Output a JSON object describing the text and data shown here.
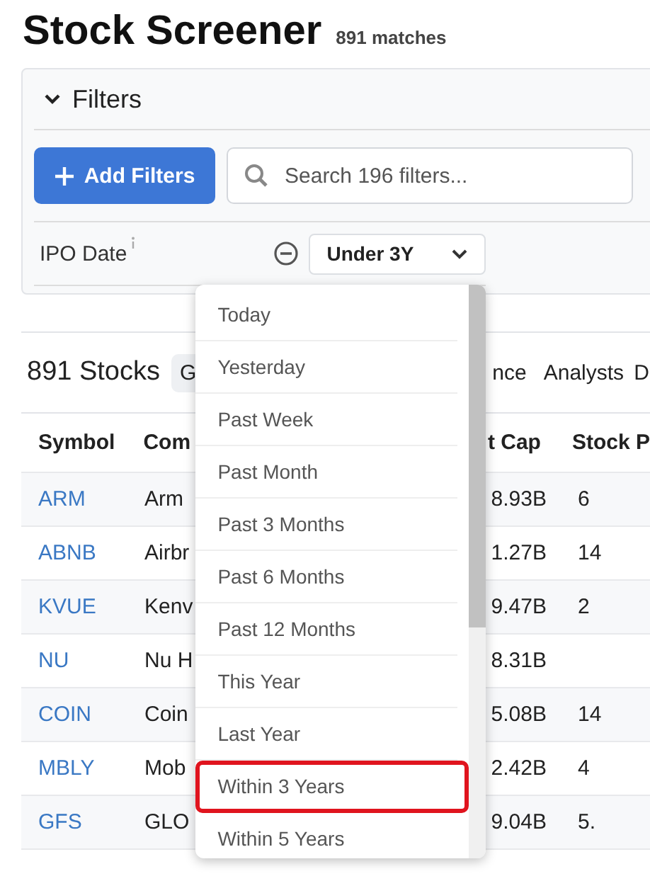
{
  "header": {
    "title": "Stock Screener",
    "matches": "891 matches"
  },
  "filters": {
    "title": "Filters",
    "expanded": true,
    "add_button": "Add Filters",
    "search": {
      "placeholder": "Search 196 filters..."
    },
    "rows": [
      {
        "label": "IPO Date",
        "value": "Under 3Y"
      }
    ]
  },
  "results": {
    "count": "891 Stocks",
    "tabs": [
      {
        "label": "G",
        "selected": true
      },
      {
        "label": "nce",
        "selected": false
      },
      {
        "label": "Analysts",
        "selected": false
      },
      {
        "label": "D",
        "selected": false
      }
    ]
  },
  "table": {
    "columns": [
      "Symbol",
      "Com",
      "t Cap",
      "Stock P"
    ],
    "rows": [
      {
        "symbol": "ARM",
        "company": "Arm",
        "market_cap": "8.93B",
        "price": "6"
      },
      {
        "symbol": "ABNB",
        "company": "Airbr",
        "market_cap": "1.27B",
        "price": "14"
      },
      {
        "symbol": "KVUE",
        "company": "Kenv",
        "market_cap": "9.47B",
        "price": "2"
      },
      {
        "symbol": "NU",
        "company": "Nu H",
        "market_cap": "8.31B"
      },
      {
        "symbol": "COIN",
        "company": "Coin",
        "market_cap": "5.08B",
        "price": "14"
      },
      {
        "symbol": "MBLY",
        "company": "Mob",
        "market_cap": "2.42B",
        "price": "4"
      },
      {
        "symbol": "GFS",
        "company": "GLO",
        "market_cap": "9.04B",
        "price": "5."
      }
    ]
  },
  "dropdown": {
    "options": [
      {
        "label": "Today",
        "selected": false
      },
      {
        "label": "Yesterday",
        "selected": false
      },
      {
        "label": "Past Week",
        "selected": false
      },
      {
        "label": "Past Month",
        "selected": false
      },
      {
        "label": "Past 3 Months",
        "selected": false
      },
      {
        "label": "Past 6 Months",
        "selected": false
      },
      {
        "label": "Past 12 Months",
        "selected": false
      },
      {
        "label": "This Year",
        "selected": false
      },
      {
        "label": "Last Year",
        "selected": false
      },
      {
        "label": "Within 3 Years",
        "selected": true
      },
      {
        "label": "Within 5 Years",
        "selected": false
      }
    ]
  }
}
